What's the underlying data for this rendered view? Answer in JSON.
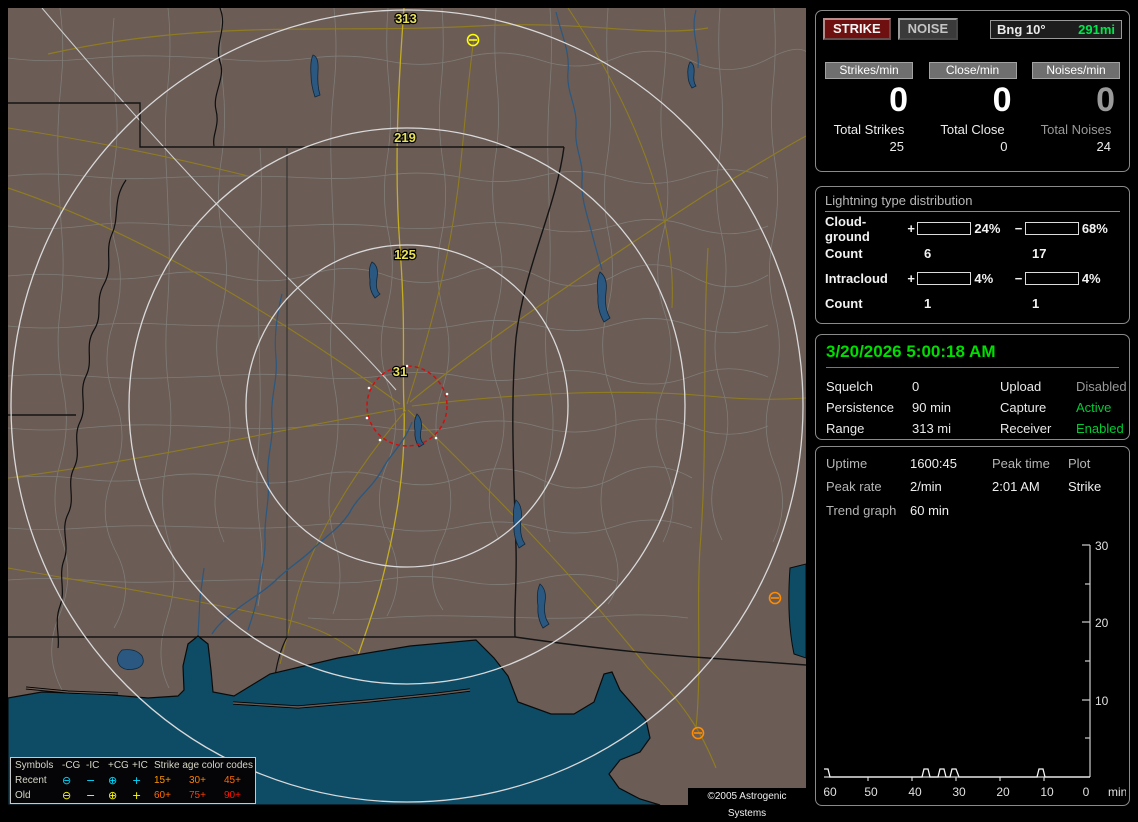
{
  "header": {
    "strike_button": "STRIKE",
    "noise_button": "NOISE",
    "bearing_label": "Bng 10°",
    "bearing_value": "291mi",
    "bearing_value_color": "#00e64d"
  },
  "counters": {
    "cols": [
      {
        "chip": "Strikes/min",
        "rate": "0",
        "total_label": "Total Strikes",
        "total_value": "25"
      },
      {
        "chip": "Close/min",
        "rate": "0",
        "total_label": "Total Close",
        "total_value": "0"
      },
      {
        "chip": "Noises/min",
        "rate": "0",
        "total_label": "Total Noises",
        "total_value": "24"
      }
    ]
  },
  "distribution": {
    "title": "Lightning type distribution",
    "cloud_ground": {
      "label": "Cloud-ground",
      "plus_sign": "+",
      "plus_pct": "24%",
      "plus_value": 24,
      "plus_color": "#ff0000",
      "minus_sign": "−",
      "minus_pct": "68%",
      "minus_value": 68,
      "minus_color": "#8fc6f0",
      "count_label": "Count",
      "plus_count": "6",
      "minus_count": "17"
    },
    "intracloud": {
      "label": "Intracloud",
      "plus_sign": "+",
      "plus_pct": "4%",
      "plus_value": 4,
      "plus_color": "#f07ac8",
      "minus_sign": "−",
      "minus_pct": "4%",
      "minus_value": 4,
      "minus_color": "#35e02a",
      "count_label": "Count",
      "plus_count": "1",
      "minus_count": "1"
    }
  },
  "clock": "3/20/2026 5:00:18 AM",
  "status": {
    "squelch_label": "Squelch",
    "squelch_value": "0",
    "persistence_label": "Persistence",
    "persistence_value": "90 min",
    "range_label": "Range",
    "range_value": "313 mi",
    "upload_label": "Upload",
    "upload_value": "Disabled",
    "capture_label": "Capture",
    "capture_value": "Active",
    "receiver_label": "Receiver",
    "receiver_value": "Enabled"
  },
  "info": {
    "uptime_label": "Uptime",
    "uptime_value": "1600:45",
    "peak_time_label": "Peak time",
    "plot_label": "Plot",
    "peak_rate_label": "Peak rate",
    "peak_rate_value": "2/min",
    "peak_time_value": "2:01 AM",
    "plot_value": "Strike",
    "trend_label": "Trend graph",
    "trend_value": "60 min"
  },
  "chart_data": {
    "type": "line",
    "title": "Trend graph",
    "window": "60 min",
    "xlabel": "min",
    "x_axis_unit": "minutes ago",
    "x_ticks": [
      60,
      50,
      40,
      30,
      20,
      10,
      0
    ],
    "y_ticks": [
      10,
      20,
      30
    ],
    "ylim": [
      0,
      30
    ],
    "xlim_minutes_ago": [
      60,
      0
    ],
    "grid": false,
    "legend_position": "none",
    "series": [
      {
        "name": "Strikes/min",
        "color": "#f5f5f5",
        "points_min_ago_vs_rate": [
          [
            60,
            1
          ],
          [
            37,
            1
          ],
          [
            33,
            1
          ],
          [
            30,
            1
          ],
          [
            11,
            1
          ]
        ],
        "baseline_value": 0
      }
    ]
  },
  "map": {
    "ring_labels": [
      "313",
      "219",
      "125",
      "31"
    ],
    "range_rings_mi": [
      125,
      219,
      313
    ],
    "close_ring_mi": 31,
    "close_ring_color": "#d01010",
    "strike_symbols": [
      {
        "symbol": "-CG",
        "age": "old",
        "color": "#ffff00"
      },
      {
        "symbol": "-CG",
        "age": "aged",
        "color": "#ff8c00"
      },
      {
        "symbol": "-CG",
        "age": "aged",
        "color": "#ff8c00"
      }
    ],
    "copyright": "©2005 Astrogenic Systems"
  },
  "legend": {
    "headers": {
      "symbols": "Symbols",
      "neg_cg": "-CG",
      "neg_ic": "-IC",
      "pos_cg": "+CG",
      "pos_ic": "+IC",
      "age_title": "Strike age color codes"
    },
    "glyphs": {
      "neg_cg": "⊖",
      "neg_ic": "−",
      "pos_cg": "⊕",
      "pos_ic": "+"
    },
    "recent": {
      "label": "Recent",
      "color": "#00dcff",
      "ages": [
        "15+",
        "30+",
        "45+"
      ]
    },
    "old": {
      "label": "Old",
      "color": "#ffff00",
      "ages": [
        "60+",
        "75+",
        "90+"
      ]
    },
    "age_colors": [
      "#ff9800",
      "#ff8000",
      "#ff6a00",
      "#ff6a00",
      "#ff3c00",
      "#ff1400"
    ]
  }
}
